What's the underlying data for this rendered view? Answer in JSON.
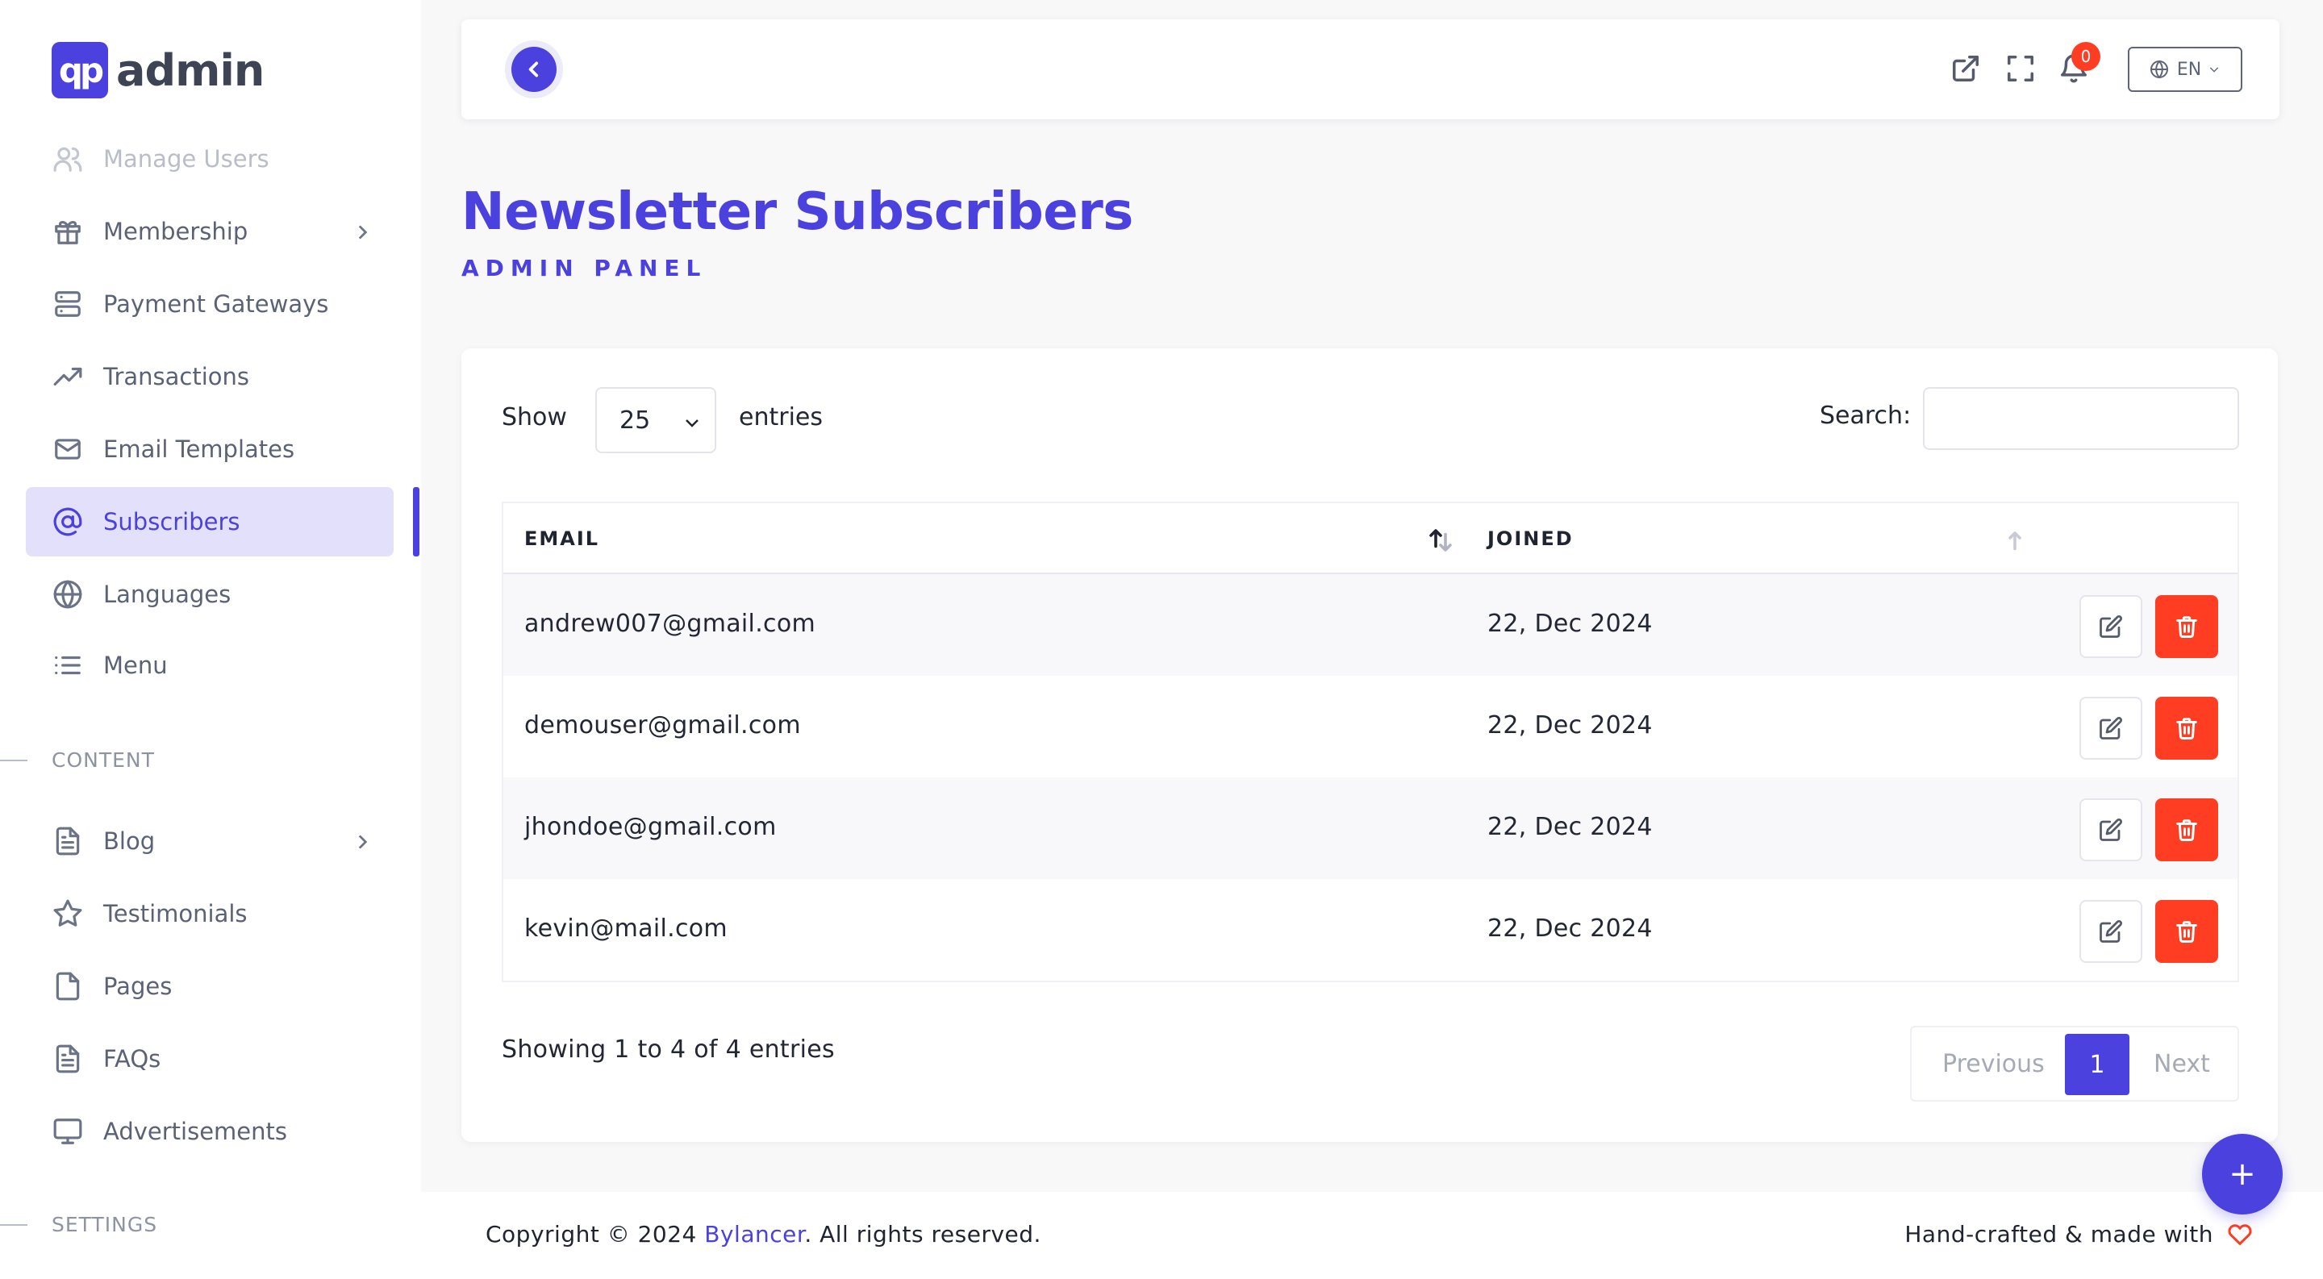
{
  "brand": {
    "logo_mark": "qp",
    "name": "admin"
  },
  "sidebar": {
    "items": [
      {
        "label": "Manage Users",
        "icon": "users-icon"
      },
      {
        "label": "Membership",
        "icon": "gift-icon",
        "has_submenu": true
      },
      {
        "label": "Payment Gateways",
        "icon": "server-icon"
      },
      {
        "label": "Transactions",
        "icon": "trending-up-icon"
      },
      {
        "label": "Email Templates",
        "icon": "mail-icon"
      },
      {
        "label": "Subscribers",
        "icon": "at-sign-icon",
        "active": true
      },
      {
        "label": "Languages",
        "icon": "globe-icon"
      },
      {
        "label": "Menu",
        "icon": "list-icon"
      }
    ],
    "section_content": "CONTENT",
    "content_items": [
      {
        "label": "Blog",
        "icon": "file-text-icon",
        "has_submenu": true
      },
      {
        "label": "Testimonials",
        "icon": "star-icon"
      },
      {
        "label": "Pages",
        "icon": "file-icon"
      },
      {
        "label": "FAQs",
        "icon": "file-text-icon"
      },
      {
        "label": "Advertisements",
        "icon": "monitor-icon"
      }
    ],
    "section_settings": "SETTINGS"
  },
  "topbar": {
    "notification_count": "0",
    "language": "EN"
  },
  "page": {
    "title": "Newsletter Subscribers",
    "subtitle": "ADMIN PANEL"
  },
  "table_controls": {
    "show_label": "Show",
    "page_size": "25",
    "entries_label": "entries",
    "search_label": "Search:",
    "search_value": ""
  },
  "table": {
    "columns": [
      "EMAIL",
      "JOINED"
    ],
    "rows": [
      {
        "email": "andrew007@gmail.com",
        "joined": "22, Dec 2024"
      },
      {
        "email": "demouser@gmail.com",
        "joined": "22, Dec 2024"
      },
      {
        "email": "jhondoe@gmail.com",
        "joined": "22, Dec 2024"
      },
      {
        "email": "kevin@mail.com",
        "joined": "22, Dec 2024"
      }
    ]
  },
  "pagination": {
    "info": "Showing 1 to 4 of 4 entries",
    "previous": "Previous",
    "current": "1",
    "next": "Next"
  },
  "footer": {
    "copyright_prefix": "Copyright © 2024 ",
    "company": "Bylancer",
    "copyright_suffix": ". All rights reserved.",
    "made_with": "Hand-crafted & made with"
  },
  "fab_label": "+",
  "colors": {
    "primary": "#4a41de",
    "danger": "#ff3d22",
    "active_bg": "#e3e0fb"
  }
}
